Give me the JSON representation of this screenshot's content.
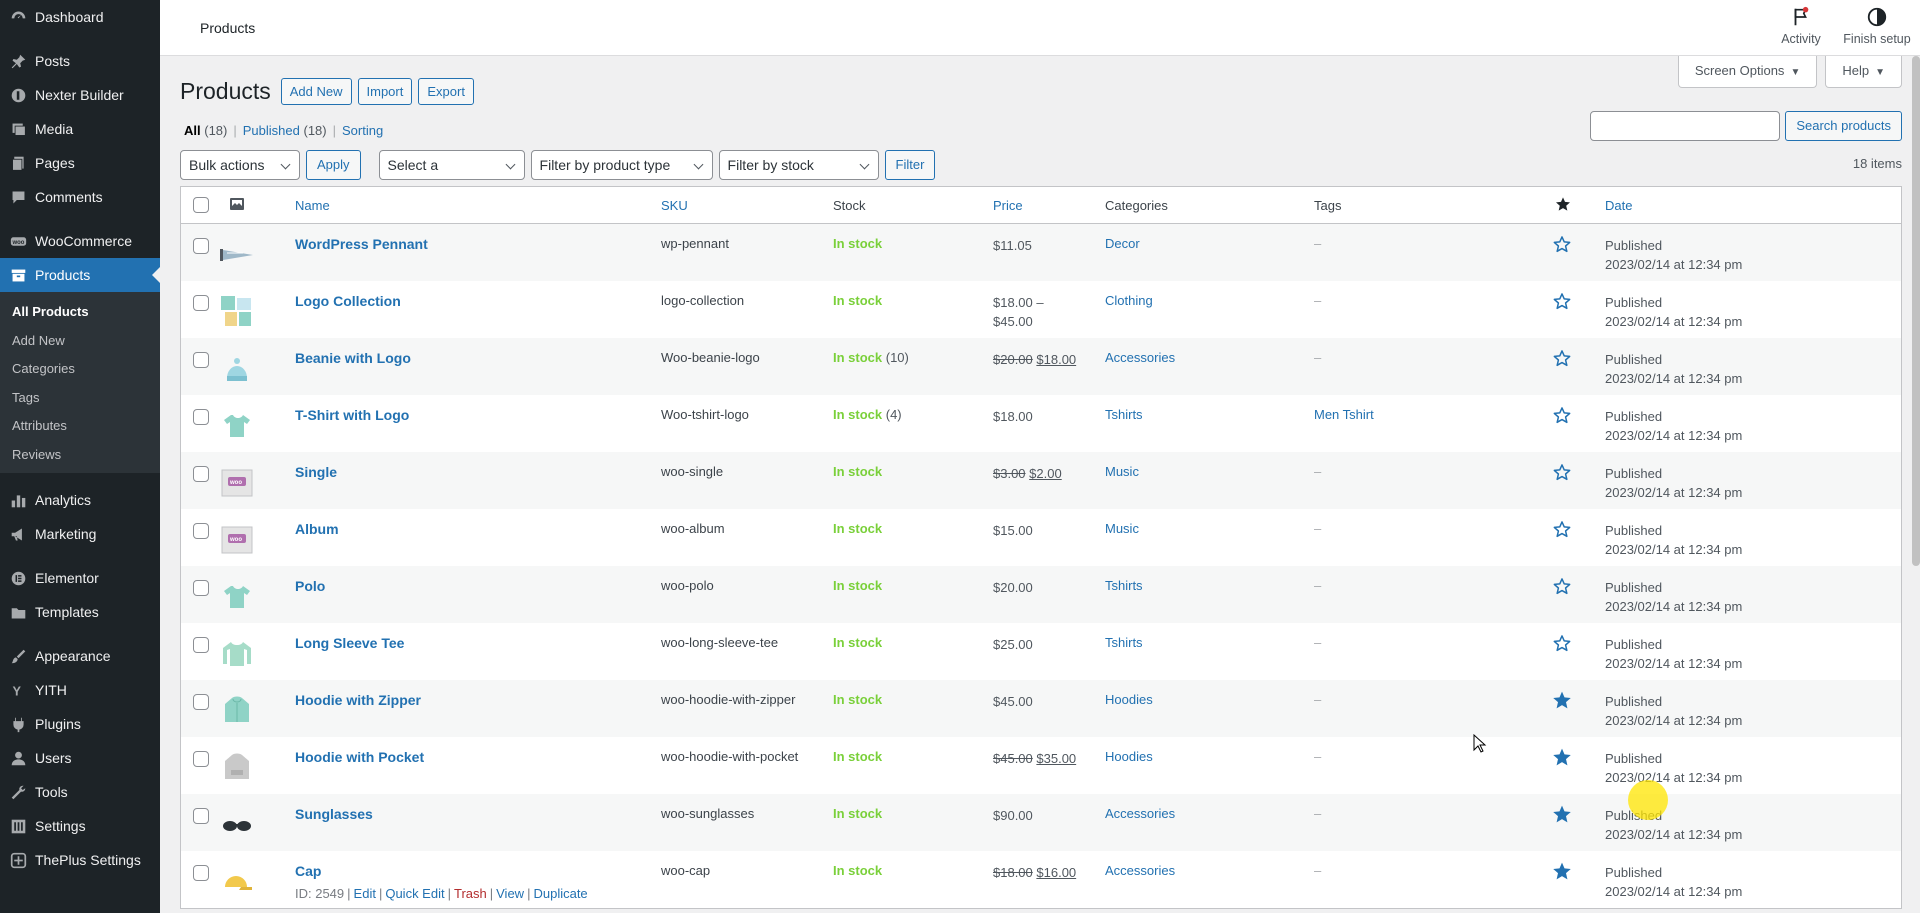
{
  "sidebar": {
    "items": [
      {
        "label": "Dashboard",
        "icon": "dashboard-icon"
      },
      {
        "label": "Posts",
        "icon": "pin-icon"
      },
      {
        "label": "Nexter Builder",
        "icon": "nexter-icon"
      },
      {
        "label": "Media",
        "icon": "media-icon"
      },
      {
        "label": "Pages",
        "icon": "pages-icon"
      },
      {
        "label": "Comments",
        "icon": "comment-icon"
      },
      {
        "label": "WooCommerce",
        "icon": "woo-icon"
      },
      {
        "label": "Products",
        "icon": "archive-icon"
      },
      {
        "label": "Analytics",
        "icon": "chart-icon"
      },
      {
        "label": "Marketing",
        "icon": "megaphone-icon"
      },
      {
        "label": "Elementor",
        "icon": "elementor-icon"
      },
      {
        "label": "Templates",
        "icon": "folder-icon"
      },
      {
        "label": "Appearance",
        "icon": "brush-icon"
      },
      {
        "label": "YITH",
        "icon": "yith-icon"
      },
      {
        "label": "Plugins",
        "icon": "plugin-icon"
      },
      {
        "label": "Users",
        "icon": "users-icon"
      },
      {
        "label": "Tools",
        "icon": "wrench-icon"
      },
      {
        "label": "Settings",
        "icon": "settings-icon"
      },
      {
        "label": "ThePlus Settings",
        "icon": "theplus-icon"
      }
    ],
    "submenu": [
      "All Products",
      "Add New",
      "Categories",
      "Tags",
      "Attributes",
      "Reviews"
    ]
  },
  "topbar": {
    "breadcrumb": "Products",
    "activity": "Activity",
    "finish_setup": "Finish setup"
  },
  "screen_options": "Screen Options",
  "help": "Help",
  "heading": {
    "title": "Products",
    "add_new": "Add New",
    "import": "Import",
    "export": "Export"
  },
  "views": {
    "all": "All",
    "all_count": "(18)",
    "published": "Published",
    "published_count": "(18)",
    "sorting": "Sorting"
  },
  "search": {
    "button": "Search products",
    "value": ""
  },
  "filters": {
    "bulk_actions": "Bulk actions",
    "apply": "Apply",
    "category": "Select a category",
    "product_type": "Filter by product type",
    "stock_status": "Filter by stock status",
    "filter": "Filter"
  },
  "items_count": "18 items",
  "columns": {
    "name": "Name",
    "sku": "SKU",
    "stock": "Stock",
    "price": "Price",
    "categories": "Categories",
    "tags": "Tags",
    "date": "Date"
  },
  "products": [
    {
      "name": "WordPress Pennant",
      "sku": "wp-pennant",
      "stock": "In stock",
      "qty": "",
      "price": "$11.05",
      "price2": "",
      "old_price": "",
      "sale_price": "",
      "category": "Decor",
      "tags": "–",
      "featured": false,
      "status": "Published",
      "date": "2023/02/14 at 12:34 pm",
      "thumb": "pennant"
    },
    {
      "name": "Logo Collection",
      "sku": "logo-collection",
      "stock": "In stock",
      "qty": "",
      "price": "$18.00 –",
      "price2": "$45.00",
      "old_price": "",
      "sale_price": "",
      "category": "Clothing",
      "tags": "–",
      "featured": false,
      "status": "Published",
      "date": "2023/02/14 at 12:34 pm",
      "thumb": "collection"
    },
    {
      "name": "Beanie with Logo",
      "sku": "Woo-beanie-logo",
      "stock": "In stock",
      "qty": "(10)",
      "price": "",
      "price2": "",
      "old_price": "$20.00",
      "sale_price": "$18.00",
      "category": "Accessories",
      "tags": "–",
      "featured": false,
      "status": "Published",
      "date": "2023/02/14 at 12:34 pm",
      "thumb": "beanie"
    },
    {
      "name": "T-Shirt with Logo",
      "sku": "Woo-tshirt-logo",
      "stock": "In stock",
      "qty": "(4)",
      "price": "$18.00",
      "price2": "",
      "old_price": "",
      "sale_price": "",
      "category": "Tshirts",
      "tags": "Men Tshirt",
      "featured": false,
      "status": "Published",
      "date": "2023/02/14 at 12:34 pm",
      "thumb": "tshirt"
    },
    {
      "name": "Single",
      "sku": "woo-single",
      "stock": "In stock",
      "qty": "",
      "price": "",
      "price2": "",
      "old_price": "$3.00",
      "sale_price": "$2.00",
      "category": "Music",
      "tags": "–",
      "featured": false,
      "status": "Published",
      "date": "2023/02/14 at 12:34 pm",
      "thumb": "album"
    },
    {
      "name": "Album",
      "sku": "woo-album",
      "stock": "In stock",
      "qty": "",
      "price": "$15.00",
      "price2": "",
      "old_price": "",
      "sale_price": "",
      "category": "Music",
      "tags": "–",
      "featured": false,
      "status": "Published",
      "date": "2023/02/14 at 12:34 pm",
      "thumb": "album"
    },
    {
      "name": "Polo",
      "sku": "woo-polo",
      "stock": "In stock",
      "qty": "",
      "price": "$20.00",
      "price2": "",
      "old_price": "",
      "sale_price": "",
      "category": "Tshirts",
      "tags": "–",
      "featured": false,
      "status": "Published",
      "date": "2023/02/14 at 12:34 pm",
      "thumb": "tshirt"
    },
    {
      "name": "Long Sleeve Tee",
      "sku": "woo-long-sleeve-tee",
      "stock": "In stock",
      "qty": "",
      "price": "$25.00",
      "price2": "",
      "old_price": "",
      "sale_price": "",
      "category": "Tshirts",
      "tags": "–",
      "featured": false,
      "status": "Published",
      "date": "2023/02/14 at 12:34 pm",
      "thumb": "longsleeve"
    },
    {
      "name": "Hoodie with Zipper",
      "sku": "woo-hoodie-with-zipper",
      "stock": "In stock",
      "qty": "",
      "price": "$45.00",
      "price2": "",
      "old_price": "",
      "sale_price": "",
      "category": "Hoodies",
      "tags": "–",
      "featured": true,
      "status": "Published",
      "date": "2023/02/14 at 12:34 pm",
      "thumb": "hoodie"
    },
    {
      "name": "Hoodie with Pocket",
      "sku": "woo-hoodie-with-pocket",
      "stock": "In stock",
      "qty": "",
      "price": "",
      "price2": "",
      "old_price": "$45.00",
      "sale_price": "$35.00",
      "category": "Hoodies",
      "tags": "–",
      "featured": true,
      "status": "Published",
      "date": "2023/02/14 at 12:34 pm",
      "thumb": "hoodiegrey"
    },
    {
      "name": "Sunglasses",
      "sku": "woo-sunglasses",
      "stock": "In stock",
      "qty": "",
      "price": "$90.00",
      "price2": "",
      "old_price": "",
      "sale_price": "",
      "category": "Accessories",
      "tags": "–",
      "featured": true,
      "status": "Published",
      "date": "2023/02/14 at 12:34 pm",
      "thumb": "sunglasses"
    },
    {
      "name": "Cap",
      "sku": "woo-cap",
      "stock": "In stock",
      "qty": "",
      "price": "",
      "price2": "",
      "old_price": "$18.00",
      "sale_price": "$16.00",
      "category": "Accessories",
      "tags": "–",
      "featured": true,
      "status": "Published",
      "date": "2023/02/14 at 12:34 pm",
      "thumb": "cap",
      "row_actions": {
        "id": "ID: 2549",
        "edit": "Edit",
        "quick_edit": "Quick Edit",
        "trash": "Trash",
        "view": "View",
        "duplicate": "Duplicate"
      }
    }
  ],
  "colors": {
    "sidebar_bg": "#1d2327",
    "accent": "#2271b1",
    "in_stock": "#7ad03a",
    "trash": "#b32d2e",
    "star": "#2271b1"
  }
}
